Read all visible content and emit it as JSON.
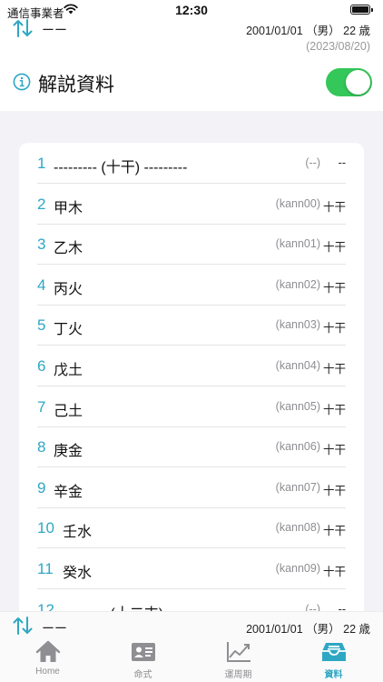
{
  "status_bar": {
    "carrier": "通信事業者",
    "time": "12:30"
  },
  "header": {
    "name": "ーー",
    "birth_info": "2001/01/01 （男） 22 歳",
    "today": "(2023/08/20)"
  },
  "toggle": {
    "label": "解説資料",
    "on": true
  },
  "list": [
    {
      "num": "1",
      "title": "--------- (十干) ---------",
      "code": "(--)",
      "category": "--"
    },
    {
      "num": "2",
      "title": "甲木",
      "code": "(kann00)",
      "category": "十干"
    },
    {
      "num": "3",
      "title": "乙木",
      "code": "(kann01)",
      "category": "十干"
    },
    {
      "num": "4",
      "title": "丙火",
      "code": "(kann02)",
      "category": "十干"
    },
    {
      "num": "5",
      "title": "丁火",
      "code": "(kann03)",
      "category": "十干"
    },
    {
      "num": "6",
      "title": "戊土",
      "code": "(kann04)",
      "category": "十干"
    },
    {
      "num": "7",
      "title": "己土",
      "code": "(kann05)",
      "category": "十干"
    },
    {
      "num": "8",
      "title": "庚金",
      "code": "(kann06)",
      "category": "十干"
    },
    {
      "num": "9",
      "title": "辛金",
      "code": "(kann07)",
      "category": "十干"
    },
    {
      "num": "10",
      "title": "壬水",
      "code": "(kann08)",
      "category": "十干"
    },
    {
      "num": "11",
      "title": "癸水",
      "code": "(kann09)",
      "category": "十干"
    },
    {
      "num": "12",
      "title": "--------- (十二支) ---------",
      "code": "(--)",
      "category": "--"
    }
  ],
  "bottom_bar": {
    "name": "ーー",
    "birth_info": "2001/01/01 （男） 22 歳"
  },
  "tabs": [
    {
      "label": "Home",
      "icon": "house-icon",
      "active": false
    },
    {
      "label": "命式",
      "icon": "id-card-icon",
      "active": false
    },
    {
      "label": "運周期",
      "icon": "line-chart-icon",
      "active": false
    },
    {
      "label": "資料",
      "icon": "inbox-tray-icon",
      "active": true
    }
  ],
  "colors": {
    "accent": "#2ea7c4",
    "switch_on": "#34c759",
    "background_grey": "#f2f2f7"
  }
}
